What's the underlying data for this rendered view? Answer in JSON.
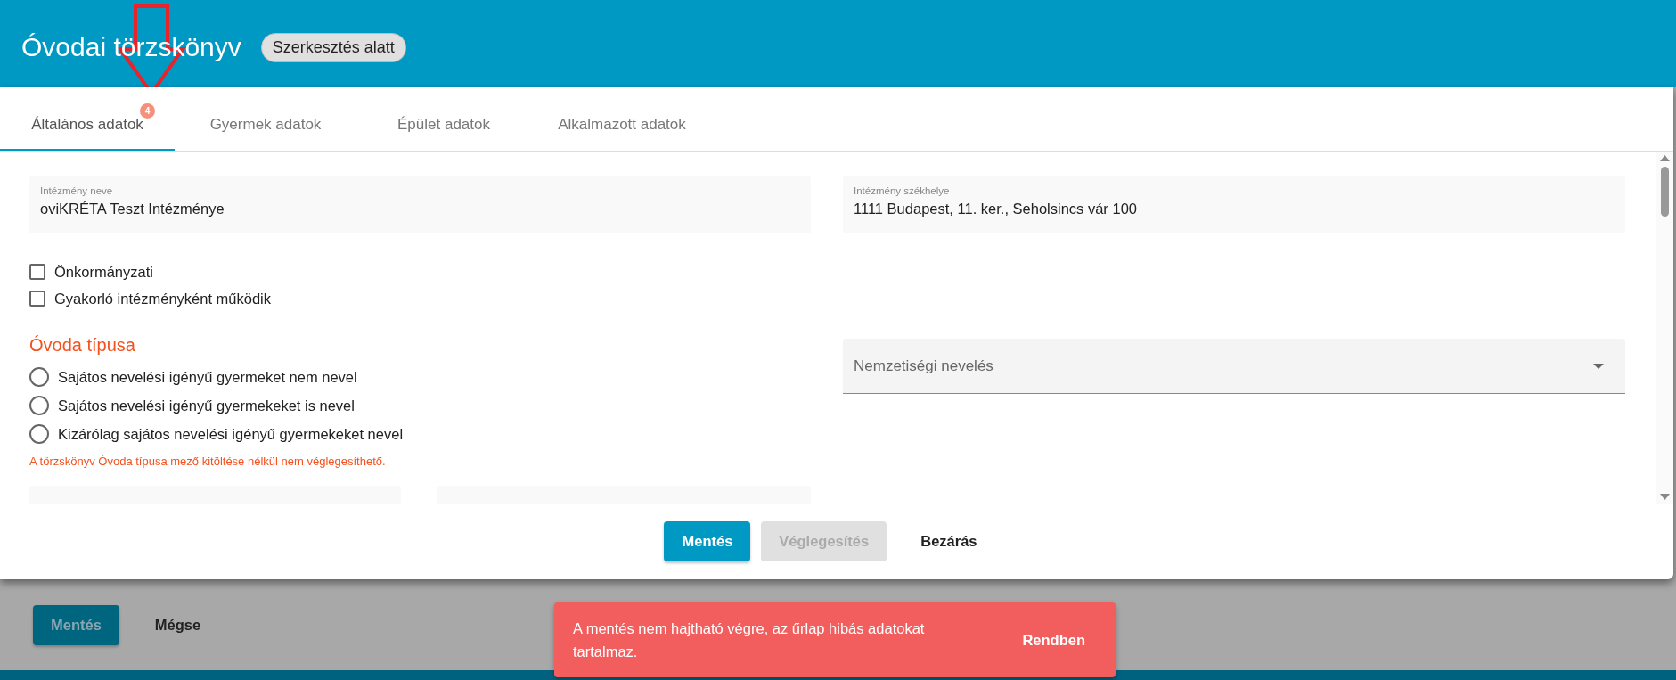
{
  "header": {
    "title": "Óvodai törzskönyv",
    "status_badge": "Szerkesztés alatt"
  },
  "tabs": [
    {
      "label": "Általános adatok",
      "selected": true,
      "badge": "4"
    },
    {
      "label": "Gyermek adatok",
      "selected": false
    },
    {
      "label": "Épület adatok",
      "selected": false
    },
    {
      "label": "Alkalmazott adatok",
      "selected": false
    }
  ],
  "fields": [
    {
      "label": "Intézmény neve",
      "value": "oviKRÉTA Teszt Intézménye"
    },
    {
      "label": "Intézmény székhelye",
      "value": "1111 Budapest, 11. ker., Seholsincs vár 100"
    }
  ],
  "checkboxes": [
    {
      "label": "Önkormányzati",
      "checked": false
    },
    {
      "label": "Gyakorló intézményként működik",
      "checked": false
    }
  ],
  "kindergarten_type": {
    "title": "Óvoda típusa",
    "options": [
      {
        "label": "Sajátos nevelési igényű gyermeket nem nevel",
        "selected": false
      },
      {
        "label": "Sajátos nevelési igényű gyermekeket is nevel",
        "selected": false
      },
      {
        "label": "Kizárólag sajátos nevelési igényű gyermekeket nevel",
        "selected": false
      }
    ],
    "error": "A törzskönyv Óvoda típusa mező kitöltése nélkül nem véglegesíthető."
  },
  "dropdown": {
    "placeholder": "Nemzetiségi nevelés"
  },
  "dialog_buttons": [
    {
      "label": "Mentés",
      "kind": "filled",
      "disabled": false
    },
    {
      "label": "Véglegesítés",
      "kind": "filled",
      "disabled": true
    },
    {
      "label": "Bezárás",
      "kind": "text",
      "disabled": false
    }
  ],
  "page_buttons": [
    {
      "label": "Mentés",
      "kind": "filled"
    },
    {
      "label": "Mégse",
      "kind": "text"
    }
  ],
  "snackbar": {
    "message": "A mentés nem hajtható végre, az űrlap hibás adatokat tartalmaz.",
    "action": "Rendben"
  }
}
